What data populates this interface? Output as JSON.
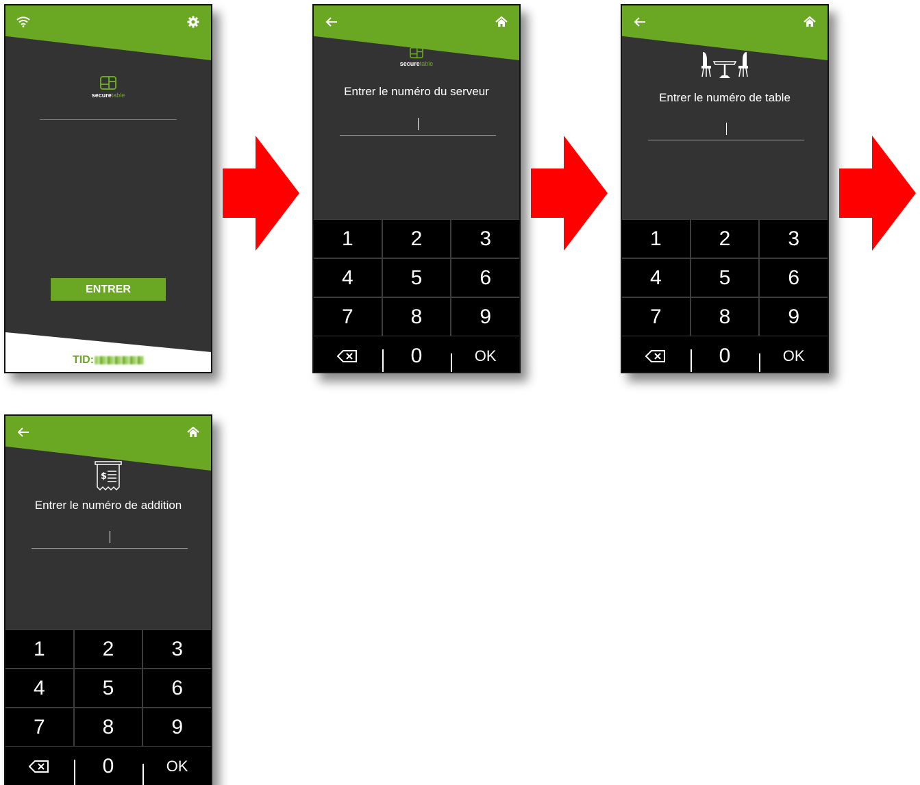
{
  "screens": [
    {
      "id": "login",
      "brand": {
        "name_part1": "secure",
        "name_part2": "table"
      },
      "enter_button": "ENTRER",
      "footer": {
        "tid_label": "TID:"
      },
      "icons": {
        "left": "wifi-icon",
        "right": "gear-icon"
      }
    },
    {
      "id": "server-number",
      "brand": {
        "name_part1": "secure",
        "name_part2": "table"
      },
      "prompt": "Entrer le numéro du serveur",
      "input_value": "",
      "icons": {
        "left": "back-arrow-icon",
        "right": "home-icon"
      }
    },
    {
      "id": "table-number",
      "prompt": "Entrer le numéro de table",
      "input_value": "",
      "icons": {
        "left": "back-arrow-icon",
        "right": "home-icon",
        "header": "table-chairs-icon"
      }
    },
    {
      "id": "bill-number",
      "prompt": "Entrer le numéro de addition",
      "input_value": "",
      "icons": {
        "left": "back-arrow-icon",
        "right": "home-icon",
        "header": "receipt-icon"
      }
    }
  ],
  "keypad": {
    "keys": [
      "1",
      "2",
      "3",
      "4",
      "5",
      "6",
      "7",
      "8",
      "9",
      "",
      "0",
      "OK"
    ]
  },
  "colors": {
    "accent_green": "#6aa823",
    "screen_bg": "#333333",
    "keypad_bg": "#000000",
    "flow_arrow": "#ff0000"
  }
}
